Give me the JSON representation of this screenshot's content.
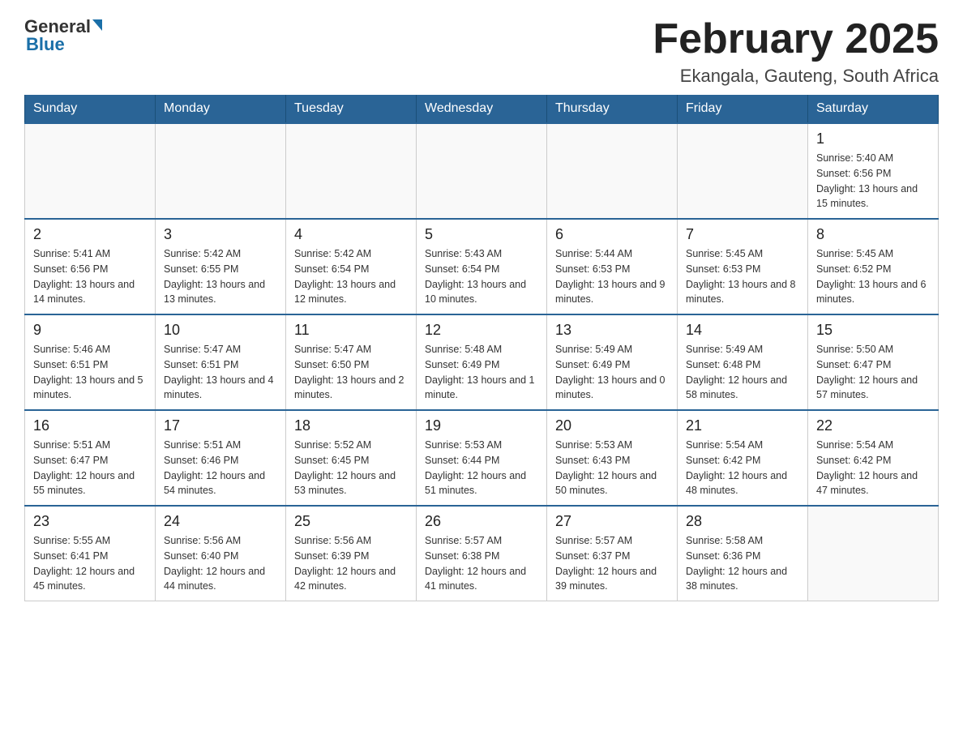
{
  "logo": {
    "general": "General",
    "blue": "Blue"
  },
  "title": "February 2025",
  "subtitle": "Ekangala, Gauteng, South Africa",
  "weekdays": [
    "Sunday",
    "Monday",
    "Tuesday",
    "Wednesday",
    "Thursday",
    "Friday",
    "Saturday"
  ],
  "weeks": [
    [
      {
        "day": "",
        "info": ""
      },
      {
        "day": "",
        "info": ""
      },
      {
        "day": "",
        "info": ""
      },
      {
        "day": "",
        "info": ""
      },
      {
        "day": "",
        "info": ""
      },
      {
        "day": "",
        "info": ""
      },
      {
        "day": "1",
        "info": "Sunrise: 5:40 AM\nSunset: 6:56 PM\nDaylight: 13 hours and 15 minutes."
      }
    ],
    [
      {
        "day": "2",
        "info": "Sunrise: 5:41 AM\nSunset: 6:56 PM\nDaylight: 13 hours and 14 minutes."
      },
      {
        "day": "3",
        "info": "Sunrise: 5:42 AM\nSunset: 6:55 PM\nDaylight: 13 hours and 13 minutes."
      },
      {
        "day": "4",
        "info": "Sunrise: 5:42 AM\nSunset: 6:54 PM\nDaylight: 13 hours and 12 minutes."
      },
      {
        "day": "5",
        "info": "Sunrise: 5:43 AM\nSunset: 6:54 PM\nDaylight: 13 hours and 10 minutes."
      },
      {
        "day": "6",
        "info": "Sunrise: 5:44 AM\nSunset: 6:53 PM\nDaylight: 13 hours and 9 minutes."
      },
      {
        "day": "7",
        "info": "Sunrise: 5:45 AM\nSunset: 6:53 PM\nDaylight: 13 hours and 8 minutes."
      },
      {
        "day": "8",
        "info": "Sunrise: 5:45 AM\nSunset: 6:52 PM\nDaylight: 13 hours and 6 minutes."
      }
    ],
    [
      {
        "day": "9",
        "info": "Sunrise: 5:46 AM\nSunset: 6:51 PM\nDaylight: 13 hours and 5 minutes."
      },
      {
        "day": "10",
        "info": "Sunrise: 5:47 AM\nSunset: 6:51 PM\nDaylight: 13 hours and 4 minutes."
      },
      {
        "day": "11",
        "info": "Sunrise: 5:47 AM\nSunset: 6:50 PM\nDaylight: 13 hours and 2 minutes."
      },
      {
        "day": "12",
        "info": "Sunrise: 5:48 AM\nSunset: 6:49 PM\nDaylight: 13 hours and 1 minute."
      },
      {
        "day": "13",
        "info": "Sunrise: 5:49 AM\nSunset: 6:49 PM\nDaylight: 13 hours and 0 minutes."
      },
      {
        "day": "14",
        "info": "Sunrise: 5:49 AM\nSunset: 6:48 PM\nDaylight: 12 hours and 58 minutes."
      },
      {
        "day": "15",
        "info": "Sunrise: 5:50 AM\nSunset: 6:47 PM\nDaylight: 12 hours and 57 minutes."
      }
    ],
    [
      {
        "day": "16",
        "info": "Sunrise: 5:51 AM\nSunset: 6:47 PM\nDaylight: 12 hours and 55 minutes."
      },
      {
        "day": "17",
        "info": "Sunrise: 5:51 AM\nSunset: 6:46 PM\nDaylight: 12 hours and 54 minutes."
      },
      {
        "day": "18",
        "info": "Sunrise: 5:52 AM\nSunset: 6:45 PM\nDaylight: 12 hours and 53 minutes."
      },
      {
        "day": "19",
        "info": "Sunrise: 5:53 AM\nSunset: 6:44 PM\nDaylight: 12 hours and 51 minutes."
      },
      {
        "day": "20",
        "info": "Sunrise: 5:53 AM\nSunset: 6:43 PM\nDaylight: 12 hours and 50 minutes."
      },
      {
        "day": "21",
        "info": "Sunrise: 5:54 AM\nSunset: 6:42 PM\nDaylight: 12 hours and 48 minutes."
      },
      {
        "day": "22",
        "info": "Sunrise: 5:54 AM\nSunset: 6:42 PM\nDaylight: 12 hours and 47 minutes."
      }
    ],
    [
      {
        "day": "23",
        "info": "Sunrise: 5:55 AM\nSunset: 6:41 PM\nDaylight: 12 hours and 45 minutes."
      },
      {
        "day": "24",
        "info": "Sunrise: 5:56 AM\nSunset: 6:40 PM\nDaylight: 12 hours and 44 minutes."
      },
      {
        "day": "25",
        "info": "Sunrise: 5:56 AM\nSunset: 6:39 PM\nDaylight: 12 hours and 42 minutes."
      },
      {
        "day": "26",
        "info": "Sunrise: 5:57 AM\nSunset: 6:38 PM\nDaylight: 12 hours and 41 minutes."
      },
      {
        "day": "27",
        "info": "Sunrise: 5:57 AM\nSunset: 6:37 PM\nDaylight: 12 hours and 39 minutes."
      },
      {
        "day": "28",
        "info": "Sunrise: 5:58 AM\nSunset: 6:36 PM\nDaylight: 12 hours and 38 minutes."
      },
      {
        "day": "",
        "info": ""
      }
    ]
  ]
}
